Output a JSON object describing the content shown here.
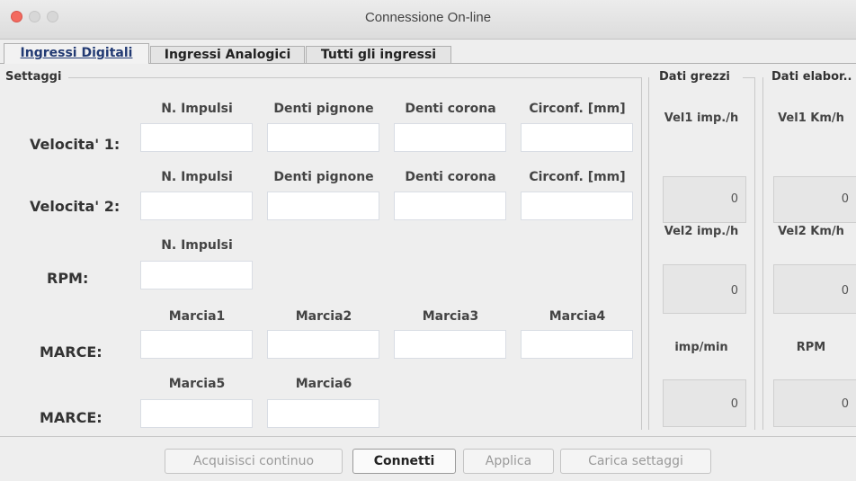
{
  "window": {
    "title": "Connessione On-line"
  },
  "tabs": [
    {
      "label": "Ingressi Digitali"
    },
    {
      "label": "Ingressi Analogici"
    },
    {
      "label": "Tutti gli ingressi"
    }
  ],
  "settaggi": {
    "group_title": "Settaggi",
    "speed1": {
      "row_label": "Velocita' 1:",
      "columns": [
        "N. Impulsi",
        "Denti pignone",
        "Denti corona",
        "Circonf. [mm]"
      ]
    },
    "speed2": {
      "row_label": "Velocita' 2:",
      "columns": [
        "N. Impulsi",
        "Denti pignone",
        "Denti corona",
        "Circonf. [mm]"
      ]
    },
    "rpm": {
      "row_label": "RPM:",
      "columns": [
        "N. Impulsi"
      ]
    },
    "marce1": {
      "row_label": "MARCE:",
      "columns": [
        "Marcia1",
        "Marcia2",
        "Marcia3",
        "Marcia4"
      ]
    },
    "marce2": {
      "row_label": "MARCE:",
      "columns": [
        "Marcia5",
        "Marcia6"
      ]
    }
  },
  "dati_grezzi": {
    "group_title": "Dati grezzi",
    "items": [
      {
        "label": "Vel1 imp./h",
        "value": "0"
      },
      {
        "label": "Vel2 imp./h",
        "value": "0"
      },
      {
        "label": "imp/min",
        "value": "0"
      }
    ]
  },
  "dati_elaborati": {
    "group_title": "Dati elabor..",
    "items": [
      {
        "label": "Vel1 Km/h",
        "value": "0"
      },
      {
        "label": "Vel2 Km/h",
        "value": "0"
      },
      {
        "label": "RPM",
        "value": "0"
      }
    ]
  },
  "buttons": {
    "acquisisci": "Acquisisci continuo",
    "connetti": "Connetti",
    "applica": "Applica",
    "carica": "Carica settaggi"
  }
}
